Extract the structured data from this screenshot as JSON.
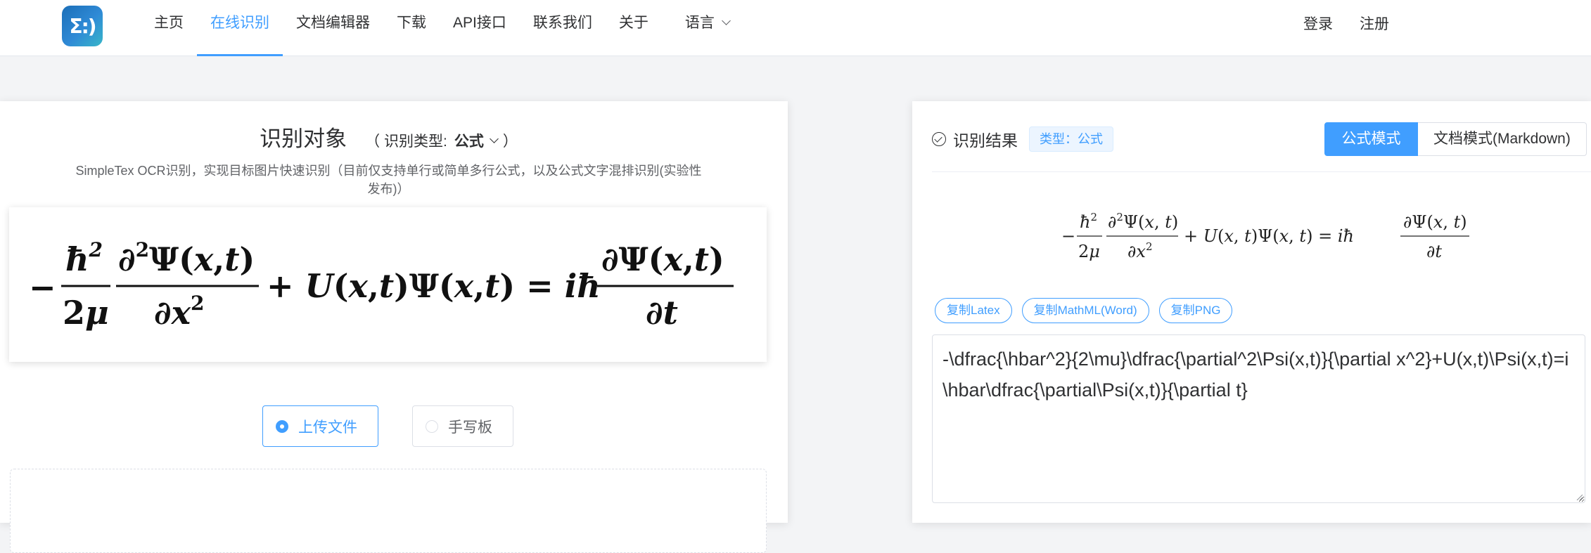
{
  "header": {
    "logo_text": "Σ:)",
    "nav": [
      {
        "label": "主页",
        "active": false
      },
      {
        "label": "在线识别",
        "active": true
      },
      {
        "label": "文档编辑器",
        "active": false
      },
      {
        "label": "下载",
        "active": false
      },
      {
        "label": "API接口",
        "active": false
      },
      {
        "label": "联系我们",
        "active": false
      },
      {
        "label": "关于",
        "active": false
      },
      {
        "label": "语言",
        "active": false
      }
    ],
    "login": "登录",
    "register": "注册"
  },
  "recognize": {
    "title": "识别对象",
    "type_open": "（ 识别类型:",
    "type_value": "公式",
    "type_close": "）",
    "description": "SimpleTex OCR识别，实现目标图片快速识别（目前仅支持单行或简单多行公式，以及公式文字混排识别(实验性发布)）",
    "modes": [
      {
        "label": "上传文件",
        "selected": true
      },
      {
        "label": "手写板",
        "selected": false
      }
    ]
  },
  "result": {
    "title": "识别结果",
    "type_tag": "类型：公式",
    "view_modes": [
      {
        "label": "公式模式",
        "active": true
      },
      {
        "label": "文档模式(Markdown)",
        "active": false
      }
    ],
    "copy_buttons": [
      "复制Latex",
      "复制MathML(Word)",
      "复制PNG"
    ],
    "latex": "-\\dfrac{\\hbar^2}{2\\mu}\\dfrac{\\partial^2\\Psi(x,t)}{\\partial x^2}+U(x,t)\\Psi(x,t)=i\\hbar\\dfrac{\\partial\\Psi(x,t)}{\\partial t}"
  },
  "colors": {
    "accent": "#409eff",
    "text": "#303133",
    "muted": "#606266",
    "tag_bg": "#ecf5ff"
  }
}
